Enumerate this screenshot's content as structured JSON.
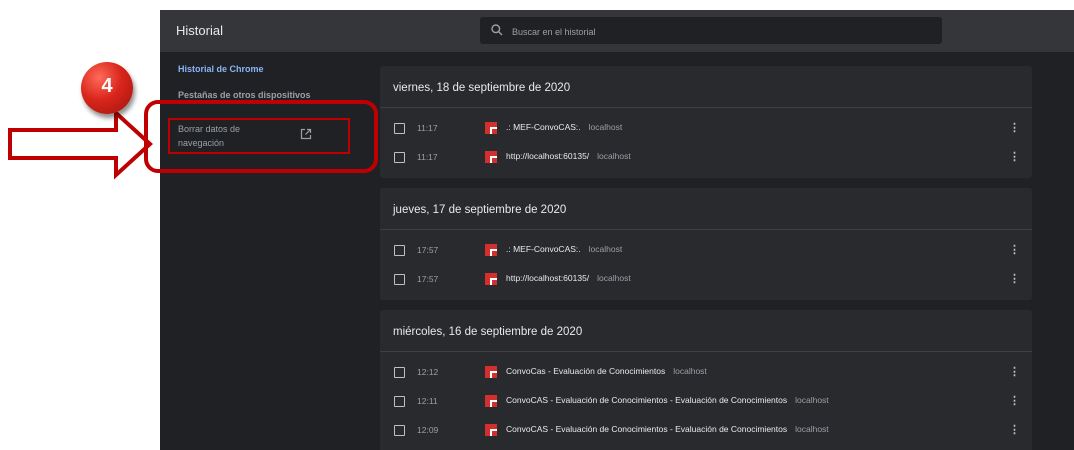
{
  "header": {
    "title": "Historial",
    "search_placeholder": "Buscar en el historial"
  },
  "sidebar": {
    "items": [
      {
        "label": "Historial de Chrome"
      },
      {
        "label": "Pestañas de otros dispositivos"
      },
      {
        "label_line1": "Borrar datos de",
        "label_line2": "navegación"
      }
    ]
  },
  "annotation": {
    "step_number": "4",
    "colors": {
      "red": "#c00000"
    }
  },
  "history": [
    {
      "date": "viernes, 18 de septiembre de 2020",
      "entries": [
        {
          "time": "11:17",
          "title": ".: MEF-ConvoCAS:.",
          "domain": "localhost"
        },
        {
          "time": "11:17",
          "title": "http://localhost:60135/",
          "domain": "localhost"
        }
      ]
    },
    {
      "date": "jueves, 17 de septiembre de 2020",
      "entries": [
        {
          "time": "17:57",
          "title": ".: MEF-ConvoCAS:.",
          "domain": "localhost"
        },
        {
          "time": "17:57",
          "title": "http://localhost:60135/",
          "domain": "localhost"
        }
      ]
    },
    {
      "date": "miércoles, 16 de septiembre de 2020",
      "entries": [
        {
          "time": "12:12",
          "title": "ConvoCas - Evaluación de Conocimientos",
          "domain": "localhost"
        },
        {
          "time": "12:11",
          "title": "ConvoCAS - Evaluación de Conocimientos - Evaluación de Conocimientos",
          "domain": "localhost"
        },
        {
          "time": "12:09",
          "title": "ConvoCAS - Evaluación de Conocimientos - Evaluación de Conocimientos",
          "domain": "localhost"
        }
      ]
    }
  ],
  "icons": {
    "search": "search-icon",
    "external_link": "external-link-icon",
    "favicon": "site-favicon-icon",
    "more": "more-vert-icon",
    "checkbox": "checkbox"
  }
}
